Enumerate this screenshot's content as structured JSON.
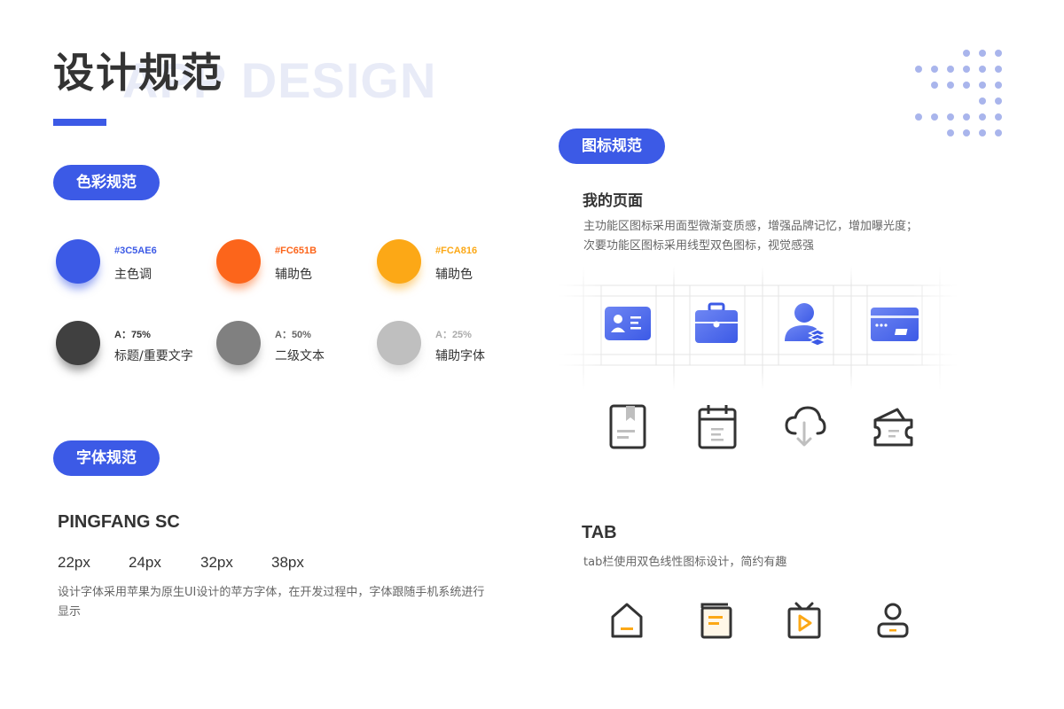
{
  "header": {
    "title": "设计规范",
    "bg_title": "APP DESIGN"
  },
  "color_section": {
    "pill": "色彩规范",
    "swatches": [
      {
        "code": "#3C5AE6",
        "label": "主色调",
        "color": "#3C5AE6",
        "code_color": "#3C5AE6"
      },
      {
        "code": "#FC651B",
        "label": "辅助色",
        "color": "#FC651B",
        "code_color": "#FC651B"
      },
      {
        "code": "#FCA816",
        "label": "辅助色",
        "color": "#FCA816",
        "code_color": "#FCA816"
      },
      {
        "code": "A：75%",
        "label": "标题/重要文字",
        "color": "#404040",
        "code_color": "#333333"
      },
      {
        "code": "A：50%",
        "label": "二级文本",
        "color": "#808080",
        "code_color": "#666666"
      },
      {
        "code": "A：25%",
        "label": "辅助字体",
        "color": "#BFBFBF",
        "code_color": "#AAAAAA"
      }
    ]
  },
  "font_section": {
    "pill": "字体规范",
    "font_name": "PINGFANG SC",
    "sizes": [
      "22px",
      "24px",
      "32px",
      "38px"
    ],
    "description": "设计字体采用苹果为原生UI设计的苹方字体，在开发过程中，字体跟随手机系统进行显示"
  },
  "icon_section": {
    "pill": "图标规范",
    "my_page_title": "我的页面",
    "my_page_desc_1": "主功能区图标采用面型微渐变质感，增强品牌记忆，增加曝光度；",
    "my_page_desc_2": "次要功能区图标采用线型双色图标，视觉感强",
    "filled_icons": [
      "id-card-icon",
      "briefcase-icon",
      "user-stack-icon",
      "credit-card-icon"
    ],
    "line_icons": [
      "bookmark-book-icon",
      "calendar-notes-icon",
      "cloud-download-icon",
      "wallet-icon"
    ],
    "tab_title": "TAB",
    "tab_desc": "tab栏使用双色线性图标设计，简约有趣",
    "tab_icons": [
      "home-icon",
      "document-icon",
      "tv-play-icon",
      "profile-icon"
    ]
  },
  "colors": {
    "primary": "#3C5AE6",
    "accent_orange": "#FC651B",
    "accent_yellow": "#FCA816",
    "dot_color": "#A9B5EC"
  }
}
